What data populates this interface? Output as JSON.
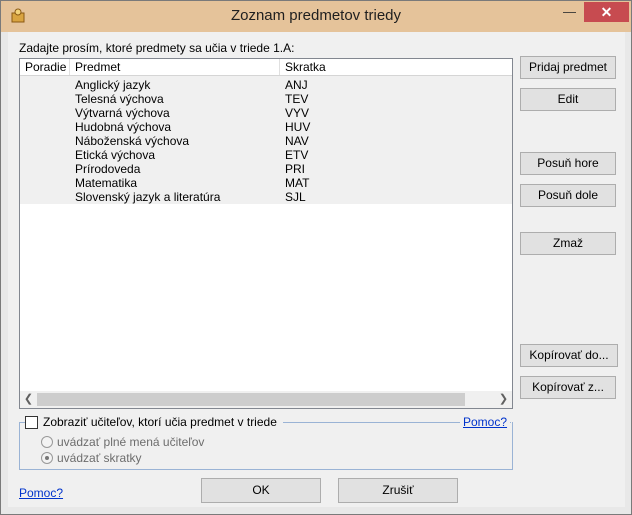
{
  "window": {
    "title": "Zoznam predmetov triedy",
    "close_glyph": "✕",
    "minimize_glyph": "—"
  },
  "prompt": "Zadajte prosím, ktoré predmety sa učia v triede 1.A:",
  "list": {
    "columns": [
      "Poradie",
      "Predmet",
      "Skratka"
    ],
    "rows": [
      {
        "poradie": "",
        "predmet": "Anglický jazyk",
        "skratka": "ANJ"
      },
      {
        "poradie": "",
        "predmet": "Telesná výchova",
        "skratka": "TEV"
      },
      {
        "poradie": "",
        "predmet": "Výtvarná výchova",
        "skratka": "VYV"
      },
      {
        "poradie": "",
        "predmet": "Hudobná výchova",
        "skratka": "HUV"
      },
      {
        "poradie": "",
        "predmet": "Náboženská výchova",
        "skratka": "NAV"
      },
      {
        "poradie": "",
        "predmet": "Etická výchova",
        "skratka": "ETV"
      },
      {
        "poradie": "",
        "predmet": "Prírodoveda",
        "skratka": "PRI"
      },
      {
        "poradie": "",
        "predmet": "Matematika",
        "skratka": "MAT"
      },
      {
        "poradie": "",
        "predmet": "Slovenský jazyk a literatúra",
        "skratka": "SJL"
      }
    ]
  },
  "buttons": {
    "add": "Pridaj predmet",
    "edit": "Edit",
    "up": "Posuň hore",
    "down": "Posuň dole",
    "delete": "Zmaž",
    "copy_to": "Kopírovať do...",
    "copy_from": "Kopírovať z...",
    "ok": "OK",
    "cancel": "Zrušiť"
  },
  "teachers": {
    "checkbox_label": "Zobraziť učiteľov, ktorí učia predmet v triede",
    "checked": false,
    "help": "Pomoc?",
    "radio_full": "uvádzať plné mená učiteľov",
    "radio_short": "uvádzať skratky",
    "selected": "short"
  },
  "help_bottom": "Pomoc?"
}
